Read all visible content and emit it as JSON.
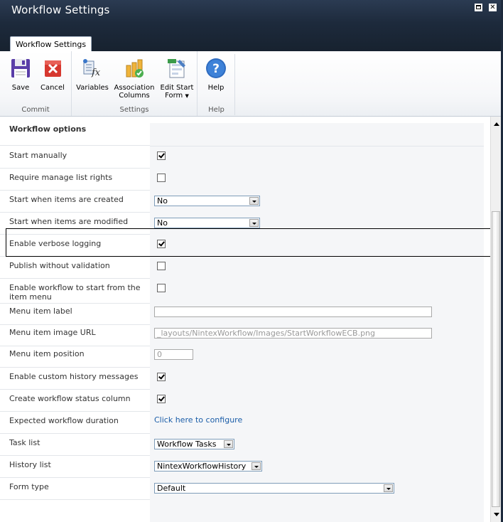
{
  "window": {
    "title": "Workflow Settings",
    "maximize_icon": "maximize-icon",
    "close_icon": "close-icon",
    "close_glyph": "✕"
  },
  "ribbon": {
    "tab_label": "Workflow Settings",
    "groups": {
      "commit": "Commit",
      "settings": "Settings",
      "help": "Help"
    },
    "buttons": {
      "save": "Save",
      "cancel": "Cancel",
      "variables": "Variables",
      "association_columns_1": "Association",
      "association_columns_2": "Columns",
      "edit_start_form_1": "Edit Start",
      "edit_start_form_2": "Form",
      "help": "Help"
    }
  },
  "form": {
    "section_title": "Workflow options",
    "start_manually": {
      "label": "Start manually",
      "checked": true
    },
    "require_manage_list_rights": {
      "label": "Require manage list rights",
      "checked": false
    },
    "start_when_created": {
      "label": "Start when items are created",
      "value": "No"
    },
    "start_when_modified": {
      "label": "Start when items are modified",
      "value": "No"
    },
    "verbose_logging": {
      "label": "Enable verbose logging",
      "checked": true
    },
    "publish_without_validation": {
      "label": "Publish without validation",
      "checked": false
    },
    "enable_item_menu": {
      "label": "Enable workflow to start from the item menu",
      "checked": false
    },
    "menu_item_label": {
      "label": "Menu item label",
      "value": ""
    },
    "menu_item_image_url": {
      "label": "Menu item image URL",
      "value": "_layouts/NintexWorkflow/Images/StartWorkflowECB.png"
    },
    "menu_item_position": {
      "label": "Menu item position",
      "value": "0"
    },
    "custom_history": {
      "label": "Enable custom history messages",
      "checked": true
    },
    "status_column": {
      "label": "Create workflow status column",
      "checked": true
    },
    "expected_duration": {
      "label": "Expected workflow duration",
      "link": "Click here to configure"
    },
    "task_list": {
      "label": "Task list",
      "value": "Workflow Tasks"
    },
    "history_list": {
      "label": "History list",
      "value": "NintexWorkflowHistory"
    },
    "form_type": {
      "label": "Form type",
      "value": "Default"
    }
  },
  "colors": {
    "title_bar": "#1d2a3c",
    "link": "#1a5da8",
    "field_bg": "#f5f6f8"
  }
}
